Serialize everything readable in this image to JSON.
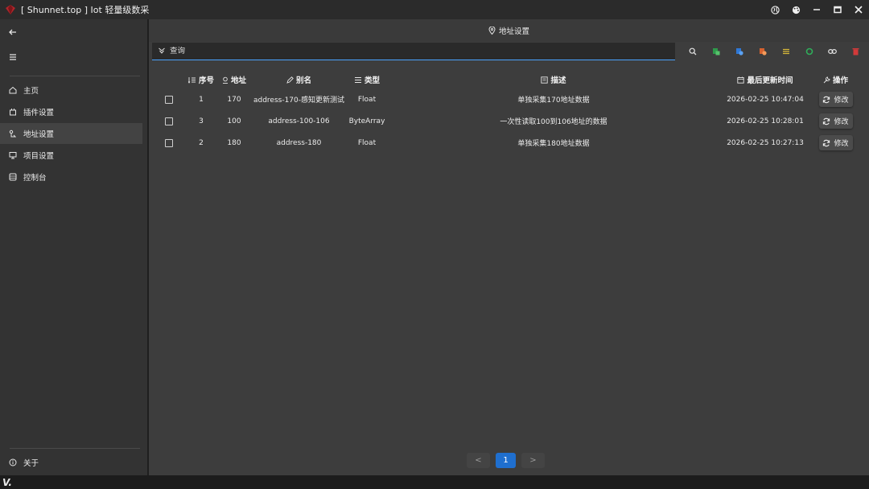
{
  "window": {
    "title": "[ Shunnet.top ] Iot 轻量级数采"
  },
  "sidebar": {
    "items": [
      {
        "label": "主页",
        "icon": "home-icon",
        "active": false
      },
      {
        "label": "插件设置",
        "icon": "plugin-icon",
        "active": false
      },
      {
        "label": "地址设置",
        "icon": "address-icon",
        "active": true
      },
      {
        "label": "项目设置",
        "icon": "monitor-icon",
        "active": false
      },
      {
        "label": "控制台",
        "icon": "console-icon",
        "active": false
      }
    ],
    "about_label": "关于"
  },
  "header": {
    "title": "地址设置"
  },
  "search": {
    "placeholder": "查询"
  },
  "toolbar": {
    "icons": [
      "search-icon",
      "excel-green-icon",
      "import-blue-icon",
      "export-orange-icon",
      "list-yellow-icon",
      "refresh-green-icon",
      "link-icon",
      "delete-red-icon"
    ]
  },
  "table": {
    "columns": [
      "序号",
      "地址",
      "别名",
      "类型",
      "描述",
      "最后更新时间",
      "操作"
    ],
    "rows": [
      {
        "seq": "1",
        "address": "170",
        "alias": "address-170-感知更新测试",
        "type": "Float",
        "desc": "单独采集170地址数据",
        "time": "2026-02-25 10:47:04",
        "action": "修改"
      },
      {
        "seq": "3",
        "address": "100",
        "alias": "address-100-106",
        "type": "ByteArray",
        "desc": "一次性读取100到106地址的数据",
        "time": "2026-02-25 10:28:01",
        "action": "修改"
      },
      {
        "seq": "2",
        "address": "180",
        "alias": "address-180",
        "type": "Float",
        "desc": "单独采集180地址数据",
        "time": "2026-02-25 10:27:13",
        "action": "修改"
      }
    ]
  },
  "pagination": {
    "prev": "<",
    "current": "1",
    "next": ">"
  },
  "watermark": {
    "text": "V."
  },
  "colors": {
    "accent": "#1f6fcf",
    "sidebar_bg": "#333333",
    "main_bg": "#3d3d3d"
  }
}
